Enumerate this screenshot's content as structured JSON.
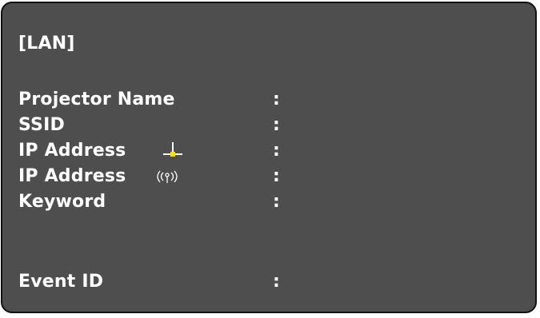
{
  "section_title": "[LAN]",
  "rows": [
    {
      "label": "Projector Name",
      "separator": ":",
      "value": ""
    },
    {
      "label": "SSID",
      "separator": ":",
      "value": ""
    },
    {
      "label": "IP Address",
      "separator": ":",
      "value": "",
      "icon": "wired-lan-icon"
    },
    {
      "label": "IP Address",
      "separator": ":",
      "value": "",
      "icon": "wireless-lan-icon"
    },
    {
      "label": "Keyword",
      "separator": ":",
      "value": ""
    }
  ],
  "event": {
    "label": "Event ID",
    "separator": ":",
    "value": ""
  },
  "colors": {
    "panel_background": "#4e4e4e",
    "panel_border": "#111111",
    "text": "#ffffff",
    "wired_icon_accent": "#ffde00"
  }
}
